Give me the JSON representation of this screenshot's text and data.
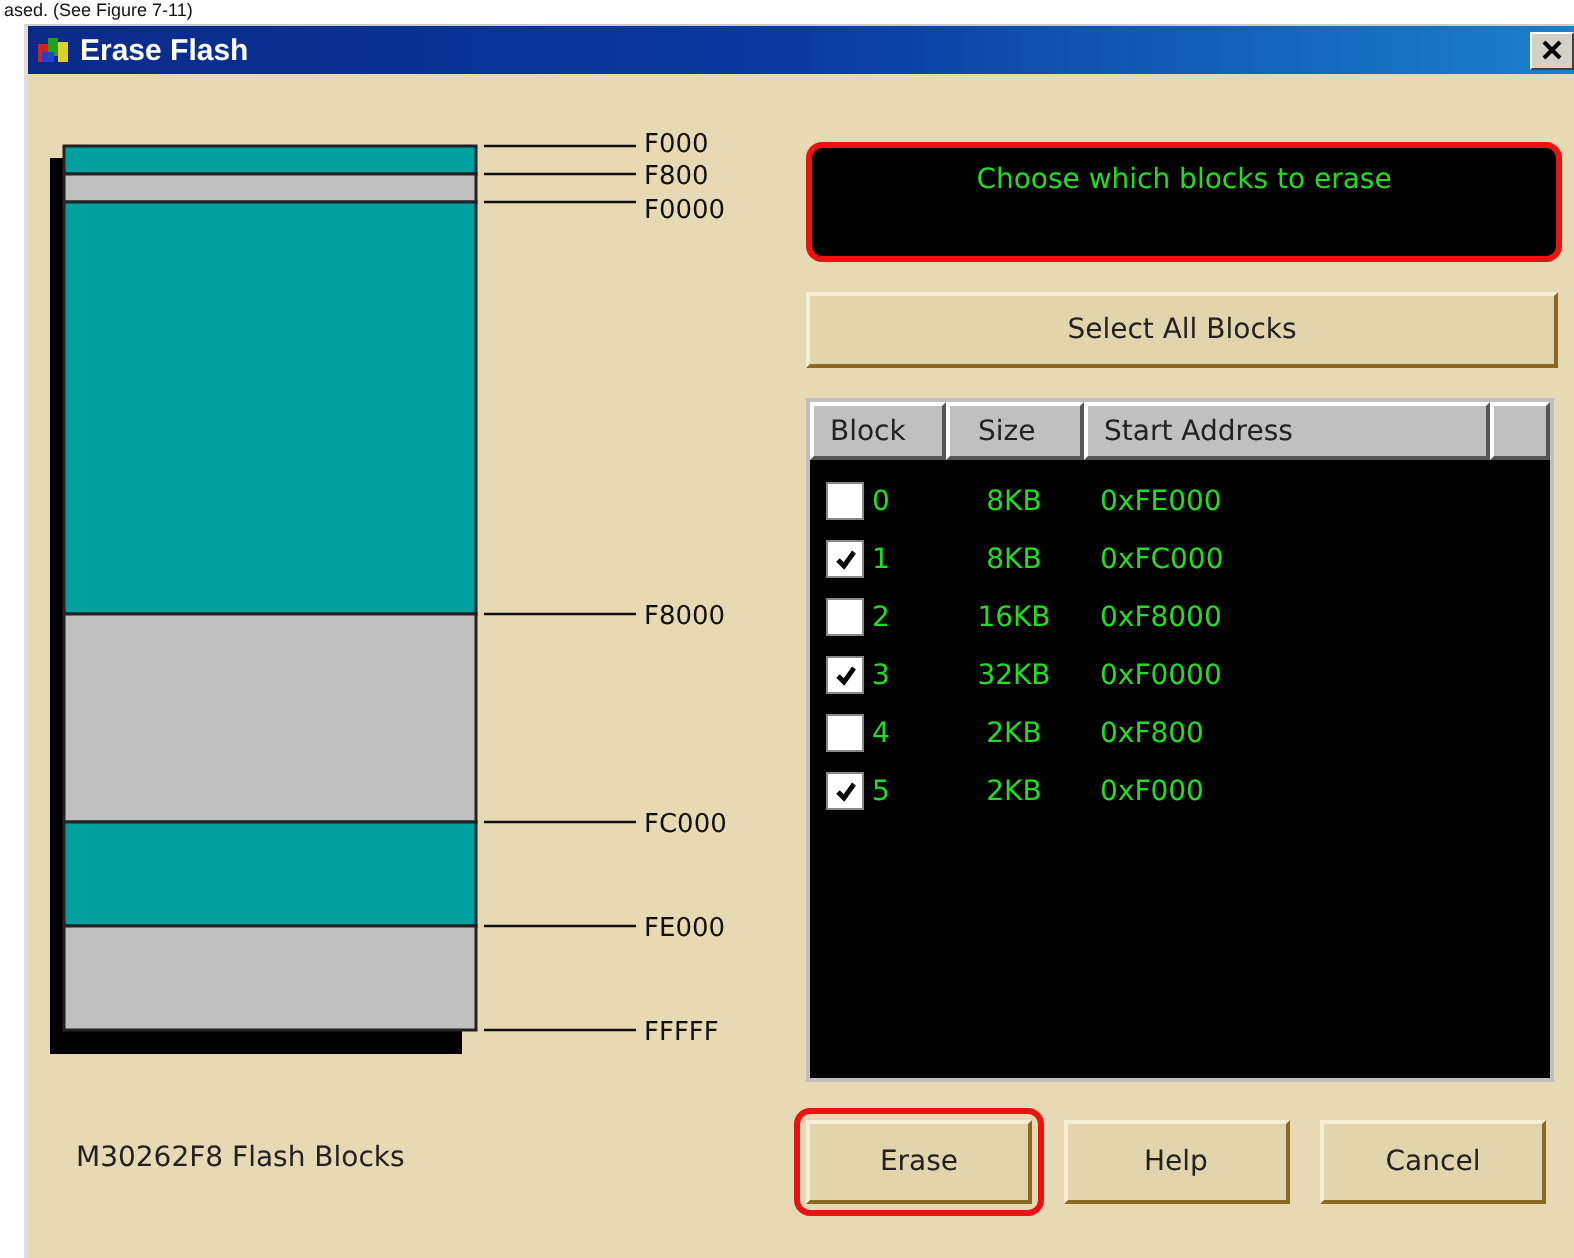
{
  "caption": "ased. (See Figure 7-11)",
  "window": {
    "title": "Erase Flash"
  },
  "memory_map": {
    "addresses": [
      "F000",
      "F800",
      "F0000",
      "F8000",
      "FC000",
      "FE000",
      "FFFFF"
    ],
    "segments": [
      {
        "highlighted": true
      },
      {
        "highlighted": false
      },
      {
        "highlighted": true
      },
      {
        "highlighted": false
      },
      {
        "highlighted": true
      },
      {
        "highlighted": false
      }
    ],
    "label": "M30262F8 Flash Blocks"
  },
  "message": {
    "text": "Choose which blocks to erase",
    "highlighted": true
  },
  "select_all_button": "Select All Blocks",
  "table": {
    "columns": [
      "Block",
      "Size",
      "Start Address"
    ],
    "rows": [
      {
        "block": "0",
        "size": "8KB",
        "address": "0xFE000",
        "checked": false
      },
      {
        "block": "1",
        "size": "8KB",
        "address": "0xFC000",
        "checked": true
      },
      {
        "block": "2",
        "size": "16KB",
        "address": "0xF8000",
        "checked": false
      },
      {
        "block": "3",
        "size": "32KB",
        "address": "0xF0000",
        "checked": true
      },
      {
        "block": "4",
        "size": "2KB",
        "address": "0xF800",
        "checked": false
      },
      {
        "block": "5",
        "size": "2KB",
        "address": "0xF000",
        "checked": true
      }
    ]
  },
  "buttons": [
    {
      "label": "Erase",
      "highlighted": true
    },
    {
      "label": "Help",
      "highlighted": false
    },
    {
      "label": "Cancel",
      "highlighted": false
    }
  ]
}
